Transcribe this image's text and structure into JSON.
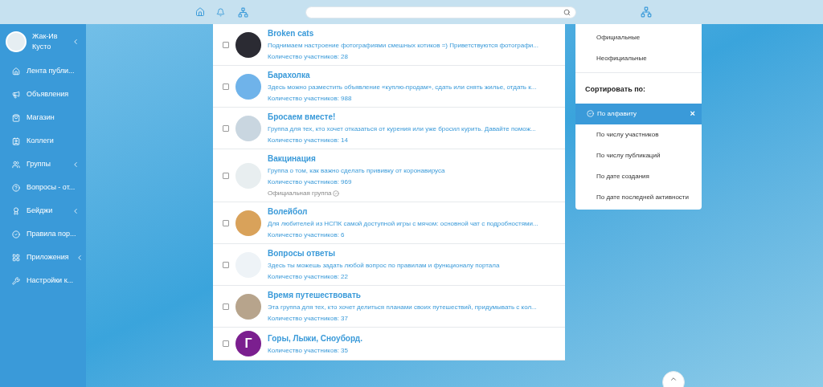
{
  "sidebar": {
    "user": {
      "name": "Жак-Ив Кусто"
    },
    "items": [
      {
        "label": "Лента публи...",
        "has_submenu": false
      },
      {
        "label": "Объявления",
        "has_submenu": false
      },
      {
        "label": "Магазин",
        "has_submenu": false
      },
      {
        "label": "Коллеги",
        "has_submenu": false
      },
      {
        "label": "Группы",
        "has_submenu": true
      },
      {
        "label": "Вопросы - от...",
        "has_submenu": false
      },
      {
        "label": "Бейджи",
        "has_submenu": true
      },
      {
        "label": "Правила пор...",
        "has_submenu": false
      },
      {
        "label": "Приложения",
        "has_submenu": true
      },
      {
        "label": "Настройки к...",
        "has_submenu": false
      }
    ]
  },
  "groups": [
    {
      "title": "Broken cats",
      "description": "Поднимаем настроение фотографиями смешных котиков =) Приветствуются фотографи...",
      "members": "Количество участников: 28",
      "avatar": {
        "kind": "photo"
      },
      "checked": false
    },
    {
      "title": "Барахолка",
      "description": "Здесь можно разместить объявление «куплю-продам», сдать или снять жилье, отдать к...",
      "members": "Количество участников: 988",
      "avatar": {
        "kind": "photo"
      },
      "checked": false
    },
    {
      "title": "Бросаем вместе!",
      "description": "Группа для тех, кто хочет отказаться от курения или уже бросил курить. Давайте помож...",
      "members": "Количество участников: 14",
      "avatar": {
        "kind": "photo"
      },
      "checked": false
    },
    {
      "title": "Вакцинация",
      "description": "Группа о том, как важно сделать прививку от коронавируса",
      "members": "Количество участников: 969",
      "badge": "Официальная группа",
      "avatar": {
        "kind": "photo"
      },
      "checked": false
    },
    {
      "title": "Волейбол",
      "description": "Для любителей из НСПК самой доступной игры с мячом: основной чат с подробностями...",
      "members": "Количество участников: 6",
      "avatar": {
        "kind": "photo"
      },
      "checked": false
    },
    {
      "title": "Вопросы ответы",
      "description": "Здесь ты можешь задать любой вопрос по правилам и функционалу портала",
      "members": "Количество участников: 22",
      "avatar": {
        "kind": "photo"
      },
      "checked": false
    },
    {
      "title": "Время путешествовать",
      "description": "Эта группа для тех, кто хочет делиться планами своих путешествий, придумывать с кол...",
      "members": "Количество участников: 37",
      "avatar": {
        "kind": "photo"
      },
      "checked": false
    },
    {
      "title": "Горы, Лыжи, Сноуборд.",
      "members": "Количество участников: 35",
      "avatar": {
        "kind": "letter",
        "letter": "Г",
        "color": "#7b1f8f"
      },
      "checked": false
    }
  ],
  "filter_menu": {
    "filters": [
      "Официальные",
      "Неофициальные"
    ],
    "sort_heading": "Сортировать по:",
    "sort_options": [
      {
        "label": "По алфавиту",
        "selected": true
      },
      {
        "label": "По числу участников",
        "selected": false
      },
      {
        "label": "По числу публикаций",
        "selected": false
      },
      {
        "label": "По дате создания",
        "selected": false
      },
      {
        "label": "По дате последней активности",
        "selected": false
      }
    ],
    "clear": "×"
  }
}
